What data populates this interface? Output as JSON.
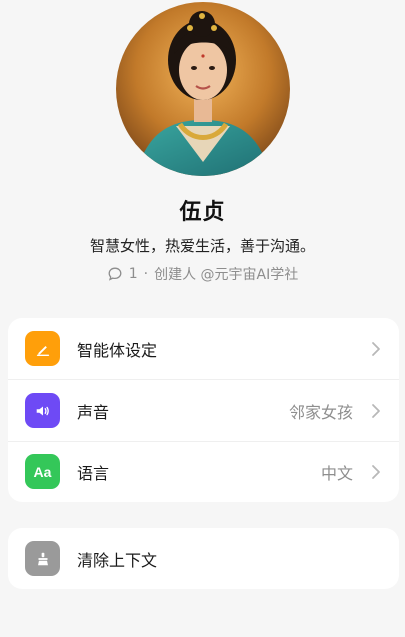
{
  "profile": {
    "name": "伍贞",
    "bio": "智慧女性，热爱生活，善于沟通。",
    "comment_count": "1",
    "separator": "·",
    "creator": "创建人 @元宇宙AI学社"
  },
  "settings": {
    "items": [
      {
        "label": "智能体设定",
        "value": "",
        "icon": "pencil-icon",
        "color": "#ff9f0a"
      },
      {
        "label": "声音",
        "value": "邻家女孩",
        "icon": "speaker-icon",
        "color": "#6e4af5"
      },
      {
        "label": "语言",
        "value": "中文",
        "icon": "language-icon",
        "icon_text": "Aa",
        "color": "#34c759"
      }
    ]
  },
  "actions": {
    "clear_context": {
      "label": "清除上下文",
      "icon": "broom-icon",
      "color": "#9a9a9a"
    }
  }
}
